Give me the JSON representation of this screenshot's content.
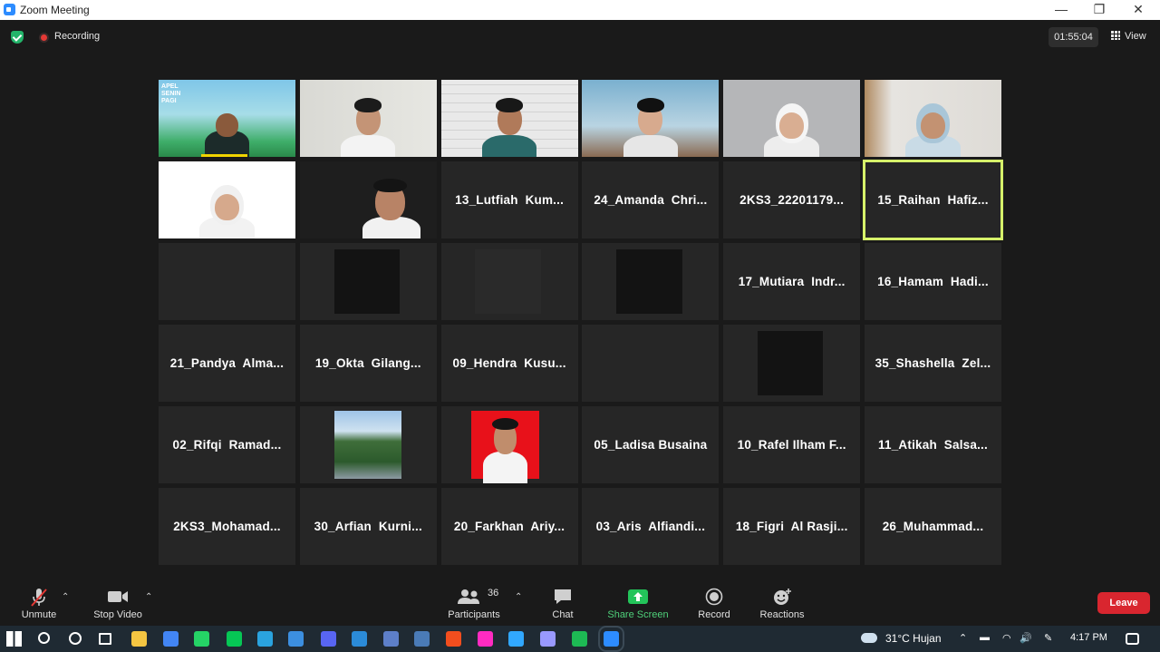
{
  "window": {
    "title": "Zoom Meeting",
    "controls": [
      "—",
      "❐",
      "✕"
    ]
  },
  "top": {
    "recording": "Recording",
    "timer": "01:55:04",
    "view": "View"
  },
  "tiles": [
    {
      "name": "",
      "kind": "video-apel"
    },
    {
      "name": "",
      "kind": "video-boy-white"
    },
    {
      "name": "",
      "kind": "video-brick"
    },
    {
      "name": "",
      "kind": "video-girl-sky"
    },
    {
      "name": "",
      "kind": "video-hijab-grey"
    },
    {
      "name": "",
      "kind": "video-hijab-room"
    },
    {
      "name": "",
      "kind": "video-hijab-white"
    },
    {
      "name": "",
      "kind": "video-boy-dark"
    },
    {
      "name": "13_Lutfiah  Kum...",
      "kind": "name"
    },
    {
      "name": "24_Amanda  Chri...",
      "kind": "name"
    },
    {
      "name": "2KS3_22201179...",
      "kind": "name"
    },
    {
      "name": "15_Raihan  Hafiz...",
      "kind": "name",
      "speaker": true
    },
    {
      "name": "",
      "kind": "blank"
    },
    {
      "name": "",
      "kind": "dark-block"
    },
    {
      "name": "",
      "kind": "faint-block"
    },
    {
      "name": "",
      "kind": "dark-block"
    },
    {
      "name": "17_Mutiara  Indr...",
      "kind": "name"
    },
    {
      "name": "16_Hamam  Hadi...",
      "kind": "name"
    },
    {
      "name": "21_Pandya  Alma...",
      "kind": "name"
    },
    {
      "name": "19_Okta  Gilang...",
      "kind": "name"
    },
    {
      "name": "09_Hendra  Kusu...",
      "kind": "name"
    },
    {
      "name": "",
      "kind": "blank"
    },
    {
      "name": "",
      "kind": "dark-block"
    },
    {
      "name": "35_Shashella  Zel...",
      "kind": "name"
    },
    {
      "name": "02_Rifqi  Ramad...",
      "kind": "name"
    },
    {
      "name": "",
      "kind": "photo-trees"
    },
    {
      "name": "",
      "kind": "photo-red"
    },
    {
      "name": "05_Ladisa Busaina",
      "kind": "name"
    },
    {
      "name": "10_Rafel Ilham F...",
      "kind": "name"
    },
    {
      "name": "11_Atikah  Salsa...",
      "kind": "name"
    },
    {
      "name": "2KS3_Mohamad...",
      "kind": "name"
    },
    {
      "name": "30_Arfian  Kurni...",
      "kind": "name"
    },
    {
      "name": "20_Farkhan  Ariy...",
      "kind": "name"
    },
    {
      "name": "03_Aris  Alfiandi...",
      "kind": "name"
    },
    {
      "name": "18_Figri  Al Rasji...",
      "kind": "name"
    },
    {
      "name": "26_Muhammad...",
      "kind": "name"
    }
  ],
  "apel_text": "APEL\nSENIN\nPAGI",
  "toolbar": {
    "unmute": "Unmute",
    "stop_video": "Stop Video",
    "participants": "Participants",
    "participants_count": "36",
    "chat": "Chat",
    "share_screen": "Share Screen",
    "record": "Record",
    "reactions": "Reactions",
    "leave": "Leave"
  },
  "taskbar": {
    "weather": "31°C  Hujan",
    "time": "4:17 PM",
    "apps": [
      "windows-start-icon",
      "search-icon",
      "cortana-icon",
      "task-view-icon",
      "file-explorer-icon",
      "chrome-icon",
      "whatsapp-icon",
      "line-icon",
      "telegram-icon",
      "mail-icon",
      "discord-icon",
      "vscode-icon",
      "r-icon",
      "app-s-icon",
      "figma-icon",
      "adobe-xd-icon",
      "photoshop-icon",
      "premiere-icon",
      "spotify-icon",
      "zoom-icon"
    ]
  },
  "colors": {
    "accent": "#2d8cff",
    "speaker_border": "#d6f16a",
    "leave": "#d9262f",
    "share_green": "#23c45a"
  }
}
